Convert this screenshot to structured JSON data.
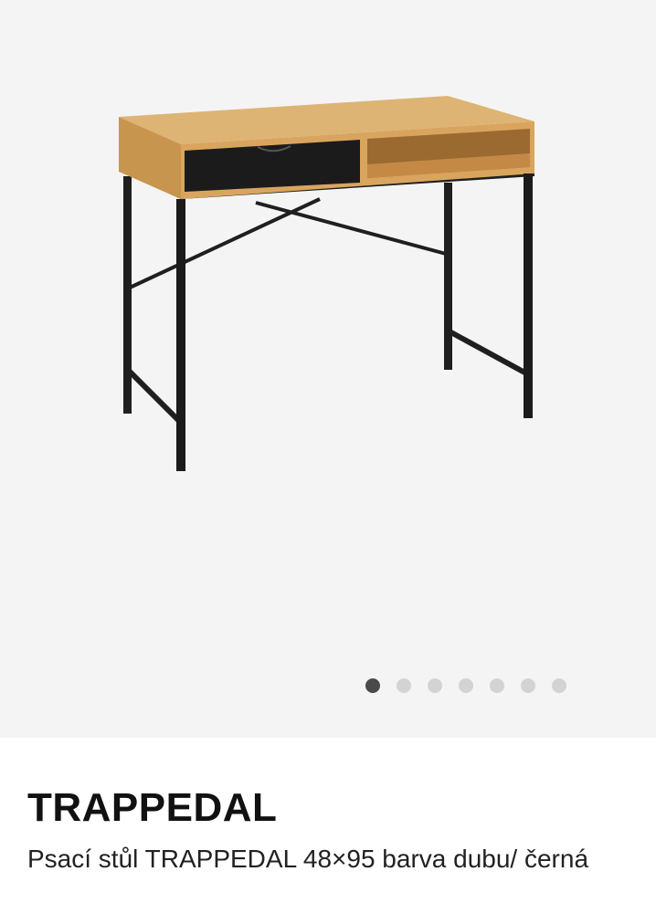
{
  "gallery": {
    "image_alt": "Psací stůl TRAPPEDAL",
    "dots": [
      {
        "active": true
      },
      {
        "active": false
      },
      {
        "active": false
      },
      {
        "active": false
      },
      {
        "active": false
      },
      {
        "active": false
      },
      {
        "active": false
      }
    ]
  },
  "product": {
    "brand": "TRAPPEDAL",
    "description": "Psací stůl TRAPPEDAL 48×95 barva dubu/ černá"
  },
  "colors": {
    "gallery_bg": "#f4f4f4",
    "dot_active": "#4a4a4a",
    "dot_inactive": "#d3d3d3",
    "oak": "#d7a55f",
    "black": "#1b1b1b"
  }
}
